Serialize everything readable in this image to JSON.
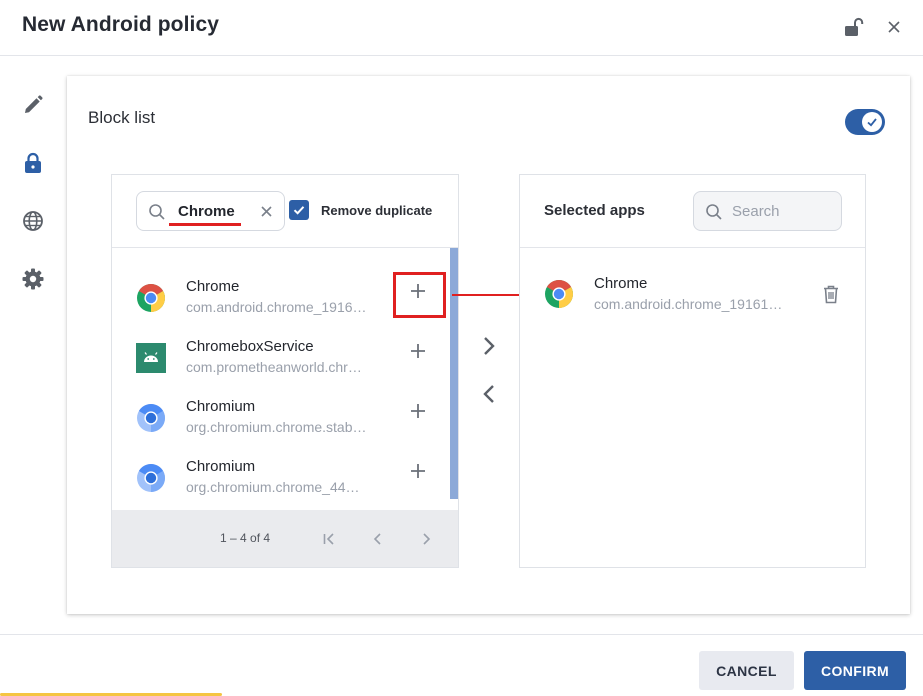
{
  "dialog": {
    "title": "New Android policy"
  },
  "block_list": {
    "label": "Block list",
    "enabled": true
  },
  "left_panel": {
    "search": {
      "value": "Chrome"
    },
    "remove_duplicate": {
      "label": "Remove duplicate",
      "checked": true
    },
    "apps": [
      {
        "name": "Chrome",
        "package": "com.android.chrome_1916…",
        "icon": "chrome-icon"
      },
      {
        "name": "ChromeboxService",
        "package": "com.prometheanworld.chr…",
        "icon": "android-icon"
      },
      {
        "name": "Chromium",
        "package": "org.chromium.chrome.stab…",
        "icon": "chromium-icon"
      },
      {
        "name": "Chromium",
        "package": "org.chromium.chrome_44…",
        "icon": "chromium-icon"
      }
    ],
    "pagination": {
      "text": "1 – 4 of 4"
    }
  },
  "right_panel": {
    "title": "Selected apps",
    "search": {
      "placeholder": "Search"
    },
    "apps": [
      {
        "name": "Chrome",
        "package": "com.android.chrome_19161…",
        "icon": "chrome-icon"
      }
    ]
  },
  "footer": {
    "cancel_label": "CANCEL",
    "confirm_label": "CONFIRM"
  },
  "colors": {
    "accent": "#2d5fa6",
    "highlight": "#e02020",
    "scrollbar": "#8ca9d8"
  }
}
